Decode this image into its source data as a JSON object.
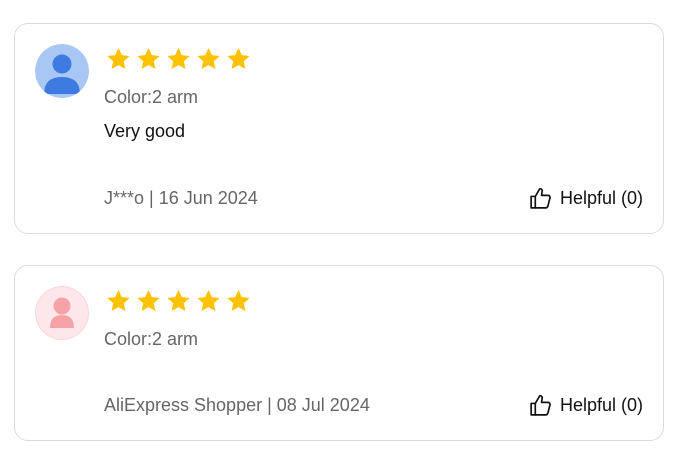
{
  "colors": {
    "star": "#ffc200",
    "avatar_male_bg": "#a8c7f5",
    "avatar_male_fg": "#3e7be0",
    "avatar_female_bg": "#fde7ea",
    "avatar_female_fg": "#f6a3a8"
  },
  "reviews": [
    {
      "avatar_icon": "user-avatar-icon",
      "rating": 5,
      "variant": "Color:2 arm",
      "text": "Very good",
      "meta": "J***o | 16 Jun 2024",
      "helpful_label": "Helpful (0)",
      "helpful_icon": "thumbs-up-icon"
    },
    {
      "avatar_icon": "user-avatar-icon",
      "rating": 5,
      "variant": "Color:2 arm",
      "meta": "AliExpress Shopper | 08 Jul 2024",
      "helpful_label": "Helpful (0)",
      "helpful_icon": "thumbs-up-icon"
    }
  ]
}
